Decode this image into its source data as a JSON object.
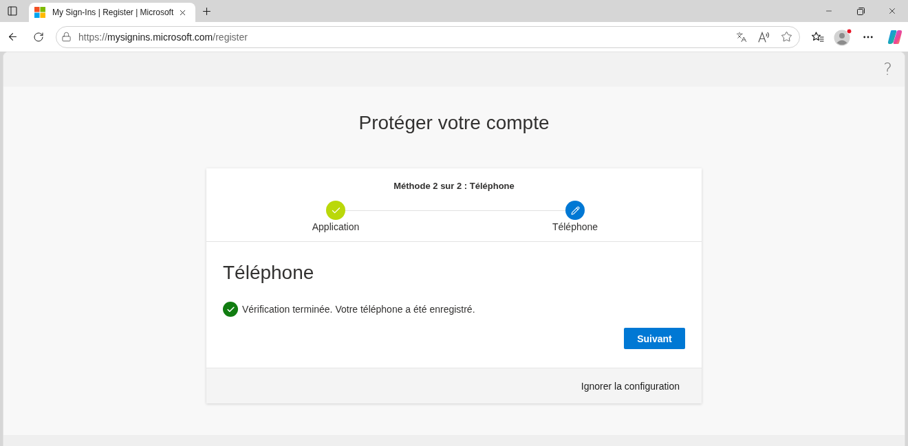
{
  "browser": {
    "tabs": [
      {
        "title": "My Sign-Ins | Register | Microsoft",
        "selected": true
      }
    ],
    "address": {
      "scheme": "https://",
      "host": "mysignins.microsoft.com",
      "path": "/register"
    }
  },
  "page": {
    "help": "?",
    "title": "Protéger votre compte"
  },
  "card": {
    "progress": "Méthode 2 sur 2 : Téléphone",
    "steps": [
      {
        "label": "Application",
        "completed": true
      },
      {
        "label": "Téléphone",
        "completed": false
      }
    ],
    "heading": "Téléphone",
    "status": {
      "kind": "success",
      "message": "Vérification terminée. Votre téléphone a été enregistré."
    },
    "primary_button": "Suivant",
    "skip_link": "Ignorer la configuration"
  }
}
